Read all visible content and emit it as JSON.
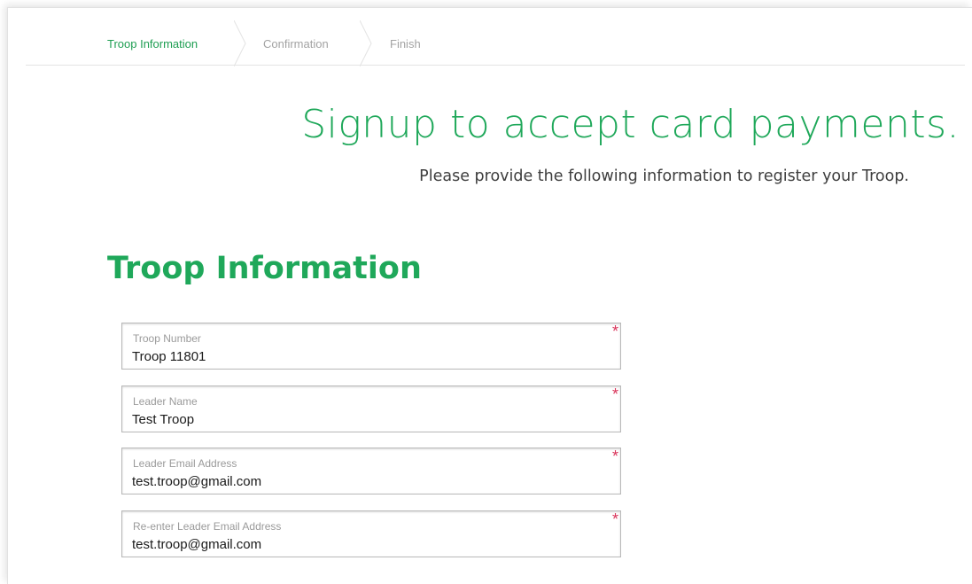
{
  "colors": {
    "brand_green": "#1fa85a",
    "active_step": "#1e9e52",
    "inactive_step": "#a3a3a3",
    "required_star": "#d9345a"
  },
  "stepper": {
    "steps": [
      {
        "label": "Troop Information",
        "state": "active"
      },
      {
        "label": "Confirmation",
        "state": "inactive"
      },
      {
        "label": "Finish",
        "state": "inactive"
      }
    ]
  },
  "header": {
    "title": "Signup to accept card payments.",
    "subtitle": "Please provide the following information to register your Troop."
  },
  "section": {
    "title": "Troop Information"
  },
  "form": {
    "fields": [
      {
        "label": "Troop Number",
        "value": "Troop 11801",
        "required_mark": "*"
      },
      {
        "label": "Leader Name",
        "value": "Test Troop",
        "required_mark": "*"
      },
      {
        "label": "Leader Email Address",
        "value": "test.troop@gmail.com",
        "required_mark": "*"
      },
      {
        "label": "Re-enter Leader Email Address",
        "value": "test.troop@gmail.com",
        "required_mark": "*"
      }
    ]
  }
}
